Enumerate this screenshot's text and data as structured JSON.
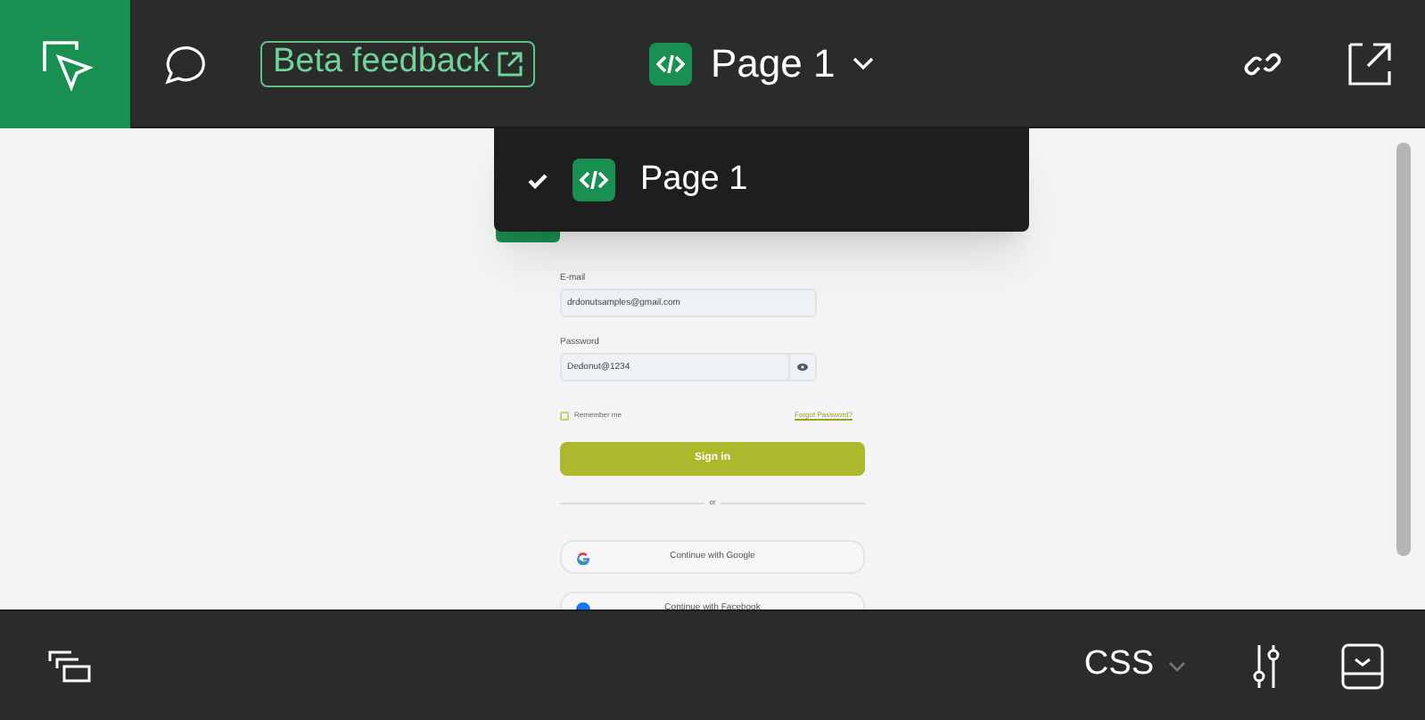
{
  "toolbar": {
    "feedback_link": "Beta feedback",
    "page_selector": "Page 1"
  },
  "page_menu": {
    "items": [
      {
        "label": "Page 1",
        "selected": true
      }
    ]
  },
  "preview": {
    "email_label": "E-mail",
    "email_value": "drdonutsamples@gmail.com",
    "password_label": "Password",
    "password_value": "Dedonut@1234",
    "remember": {
      "label": "Remember me",
      "checked": false
    },
    "forgot_link": "Forgot Password?",
    "sign_in": "Sign in",
    "divider": "or",
    "social_buttons": [
      {
        "kind": "google",
        "label": "Continue with Google"
      },
      {
        "kind": "facebook",
        "label": "Continue with Facebook"
      }
    ]
  },
  "bottom_bar": {
    "language": "CSS"
  }
}
